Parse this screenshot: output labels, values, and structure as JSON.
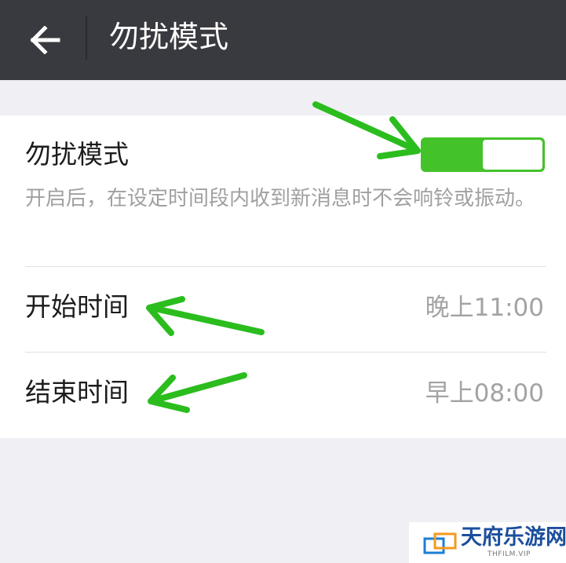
{
  "header": {
    "title": "勿扰模式",
    "back_icon": "arrow-left-icon"
  },
  "dnd": {
    "label": "勿扰模式",
    "description": "开启后，在设定时间段内收到新消息时不会响铃或振动。",
    "enabled": true
  },
  "schedule": {
    "start_label": "开始时间",
    "start_value": "晚上11:00",
    "end_label": "结束时间",
    "end_value": "早上08:00"
  },
  "colors": {
    "header_bg": "#393a3f",
    "toggle_on": "#44c22a",
    "annotation_arrow": "#2bbd1e",
    "page_bg": "#efeff4"
  },
  "watermark": {
    "brand": "天府乐游网",
    "sub": "THFILM.VIP"
  }
}
